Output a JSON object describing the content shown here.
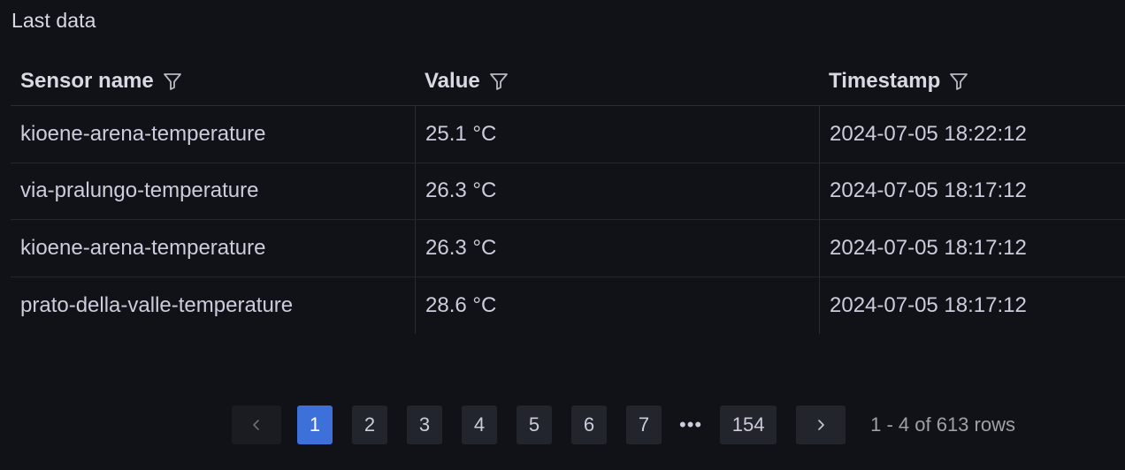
{
  "panel": {
    "title": "Last data"
  },
  "table": {
    "columns": [
      "Sensor name",
      "Value",
      "Timestamp"
    ],
    "rows": [
      [
        "kioene-arena-temperature",
        "25.1 °C",
        "2024-07-05 18:22:12"
      ],
      [
        "via-pralungo-temperature",
        "26.3 °C",
        "2024-07-05 18:17:12"
      ],
      [
        "kioene-arena-temperature",
        "26.3 °C",
        "2024-07-05 18:17:12"
      ],
      [
        "prato-della-valle-temperature",
        "28.6 °C",
        "2024-07-05 18:17:12"
      ]
    ]
  },
  "pagination": {
    "prev_icon": "chevron-left-icon",
    "next_icon": "chevron-right-icon",
    "pages": [
      "1",
      "2",
      "3",
      "4",
      "5",
      "6",
      "7"
    ],
    "current_page": "1",
    "ellipsis": "•••",
    "last_page": "154",
    "rows_info": "1 - 4 of 613 rows"
  },
  "colors": {
    "background": "#111217",
    "active_page": "#3d71d9",
    "text": "#ccccdc"
  }
}
